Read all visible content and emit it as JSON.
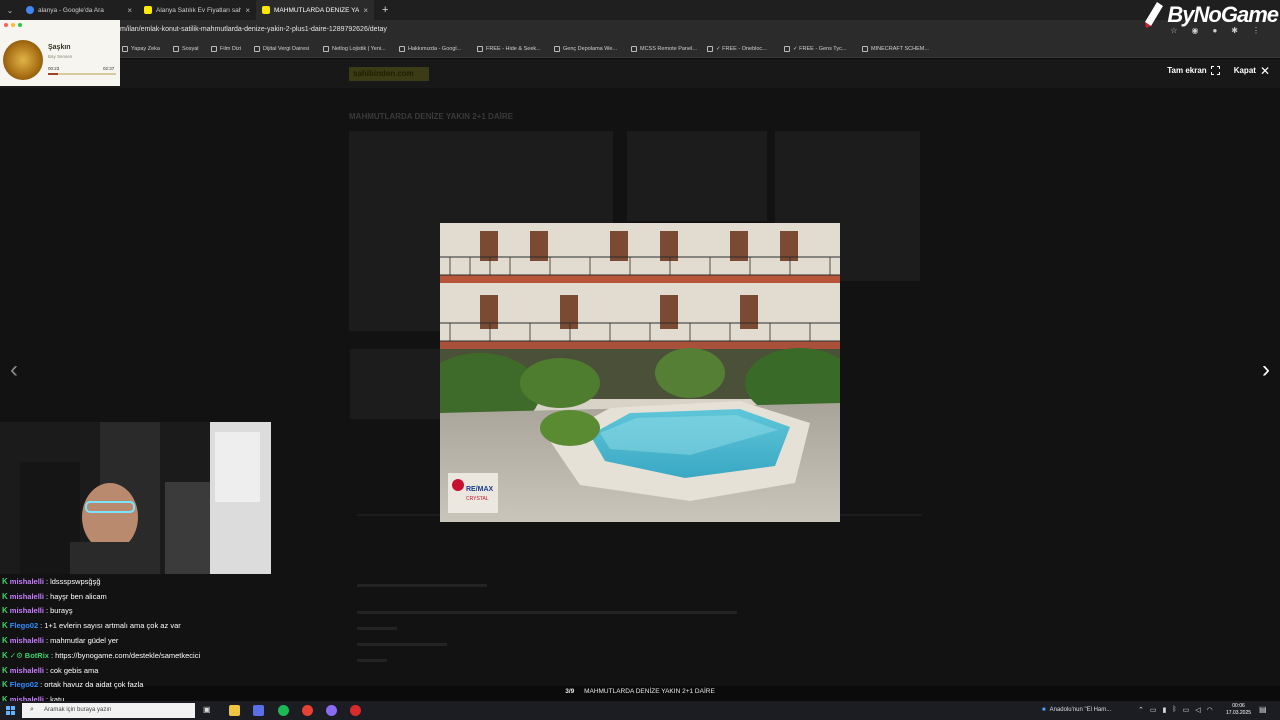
{
  "browser": {
    "tabs": [
      {
        "label": "alanya - Google'da Ara",
        "favicon_color": "#4285f4",
        "active": false
      },
      {
        "label": "Alanya Satılık Ev Fiyatları sahibi...",
        "favicon_color": "#ffe800",
        "active": false
      },
      {
        "label": "MAHMUTLARDA DENİZE YAKIN...",
        "favicon_color": "#ffe800",
        "active": true
      }
    ],
    "url": "m/ilan/emlak-konut-satilik-mahmutlarda-denize-yakin-2-plus1-daire-1289792626/detay",
    "bookmarks": [
      "Yapay Zeka",
      "Sosyal",
      "Film Dizi",
      "Dijital Vergi Dairesi",
      "Netlog Lojistik | Yeni...",
      "Hakkımızda - Googl...",
      "FREE - Hide & Seek...",
      "Genç Depolama We...",
      "MCSS Remote Panel...",
      "✓ FREE - Onebloc...",
      "✓ FREE - Gens Tyc...",
      "MINECRAFT SCHEM..."
    ]
  },
  "brand": {
    "name": "ByNoGame",
    "color": "#ffffff",
    "accent": "#d2202f"
  },
  "music": {
    "title": "Şaşkın",
    "artist": "Bay Sensen",
    "elapsed": "00:23",
    "total": "02:37",
    "progress": 0.15,
    "accent": "#a0451b"
  },
  "page": {
    "site_logo": "sahibinden.com",
    "listing_title": "MAHMUTLARDA DENİZE YAKIN 2+1 DAİRE"
  },
  "gallery": {
    "fullscreen_label": "Tam ekran",
    "close_label": "Kapat",
    "counter": "3/9",
    "caption": "MAHMUTLARDA DENİZE YAKIN 2+1 DAİRE",
    "watermark_line1": "RE/MAX",
    "watermark_line2": "CRYSTAL"
  },
  "chat": [
    {
      "user": "mishalelli",
      "color": "#c77dff",
      "message": "ldssspswpsğşğ"
    },
    {
      "user": "mishalelli",
      "color": "#c77dff",
      "message": "hayşr ben alicam"
    },
    {
      "user": "mishalelli",
      "color": "#c77dff",
      "message": "burayş"
    },
    {
      "user": "Flego02",
      "color": "#2e8cff",
      "message": "1+1 evlerin sayısı artmalı ama çok az var"
    },
    {
      "user": "mishalelli",
      "color": "#c77dff",
      "message": "mahmutlar güdel yer"
    },
    {
      "user": "BotRix",
      "color": "#3ad36a",
      "message": "https://bynogame.com/destekle/sametkecici",
      "prefix": "✓⚙"
    },
    {
      "user": "mishalelli",
      "color": "#c77dff",
      "message": "cok gebis ama"
    },
    {
      "user": "Flego02",
      "color": "#2e8cff",
      "message": "ortak havuz da aidat çok fazla"
    },
    {
      "user": "mishalelli",
      "color": "#c77dff",
      "message": "katu"
    }
  ],
  "taskbar": {
    "search_placeholder": "Aramak için buraya yazın",
    "news": "Anadolu'nun \"El Ham...",
    "time": "00:06",
    "date": "17.03.2025"
  }
}
